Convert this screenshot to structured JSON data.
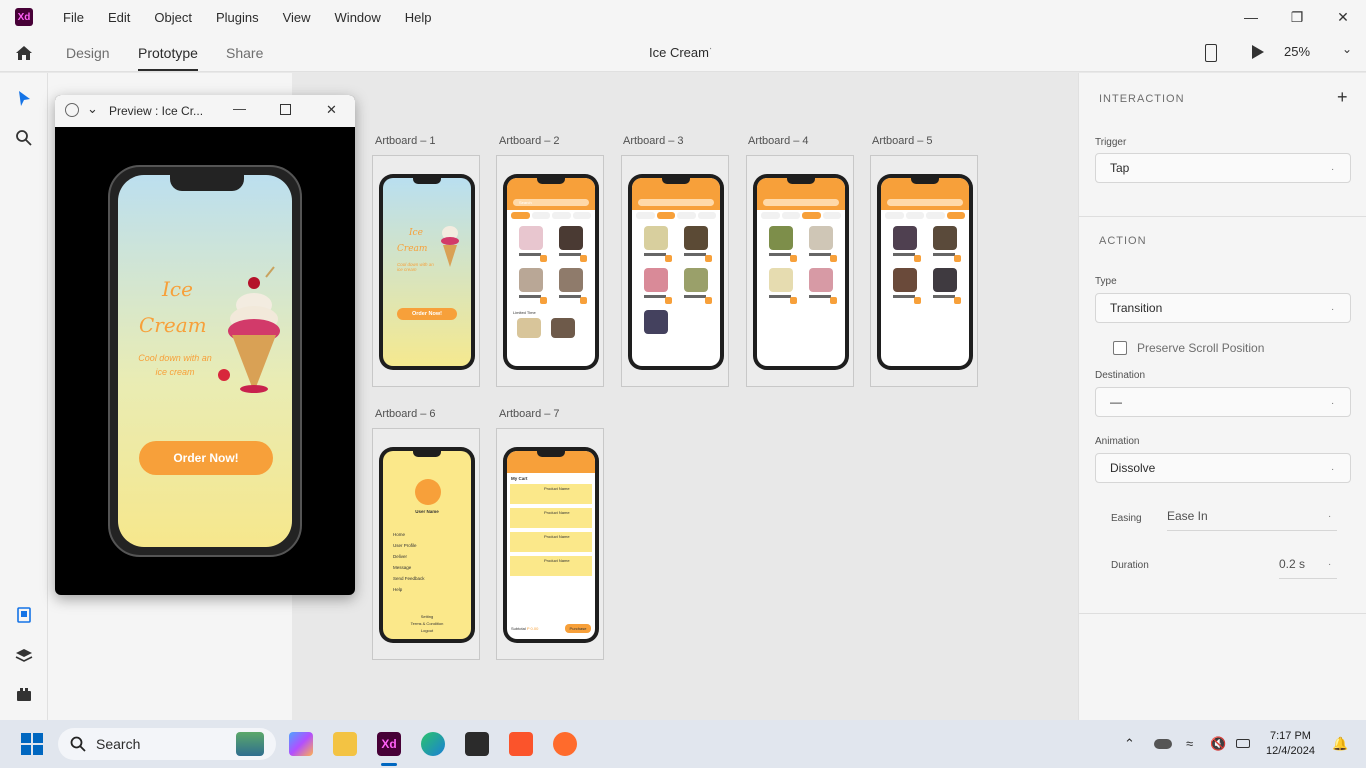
{
  "app": {
    "logo_text": "Xd",
    "menu": [
      "File",
      "Edit",
      "Object",
      "Plugins",
      "View",
      "Window",
      "Help"
    ]
  },
  "modebar": {
    "tabs": [
      "Design",
      "Prototype",
      "Share"
    ],
    "active_tab": "Prototype",
    "document_title": "Ice Cream",
    "zoom": "25%"
  },
  "preview": {
    "title": "Preview : Ice Cr...",
    "screen": {
      "title_line1": "Ice",
      "title_line2": "Cream",
      "subtitle": "Cool down with an ice cream",
      "button": "Order Now!"
    }
  },
  "artboards": [
    {
      "label": "Artboard – 1"
    },
    {
      "label": "Artboard – 2"
    },
    {
      "label": "Artboard – 3"
    },
    {
      "label": "Artboard – 4"
    },
    {
      "label": "Artboard – 5"
    },
    {
      "label": "Artboard – 6"
    },
    {
      "label": "Artboard – 7"
    }
  ],
  "mini": {
    "welcome_title_1": "Ice",
    "welcome_title_2": "Cream",
    "welcome_sub": "Cool down with an ice cream",
    "welcome_btn": "Order Now!",
    "search": "Search",
    "product": "Product Name",
    "limited": "Limited Time",
    "profile": {
      "user": "User Name",
      "items": [
        "Home",
        "User Profile",
        "Deliver",
        "Message",
        "Send Feedback",
        "Help"
      ],
      "footer": [
        "Setting",
        "Terms & Condition",
        "Logout"
      ]
    },
    "cart": {
      "title": "My Cart",
      "product": "Product Name",
      "subtotal": "Subtotal",
      "subtotal_value": "P 0.00",
      "purchase": "Purchase"
    }
  },
  "properties": {
    "interaction_title": "INTERACTION",
    "trigger_label": "Trigger",
    "trigger_value": "Tap",
    "action_title": "ACTION",
    "type_label": "Type",
    "type_value": "Transition",
    "preserve_label": "Preserve Scroll Position",
    "destination_label": "Destination",
    "destination_value": "—",
    "animation_label": "Animation",
    "animation_value": "Dissolve",
    "easing_label": "Easing",
    "easing_value": "Ease In",
    "duration_label": "Duration",
    "duration_value": "0.2 s"
  },
  "taskbar": {
    "search_placeholder": "Search",
    "time": "7:17 PM",
    "date": "12/4/2024"
  },
  "colors": {
    "accent": "#f7a03a",
    "xd_brand": "#470137",
    "xd_pink": "#ff61f6"
  }
}
